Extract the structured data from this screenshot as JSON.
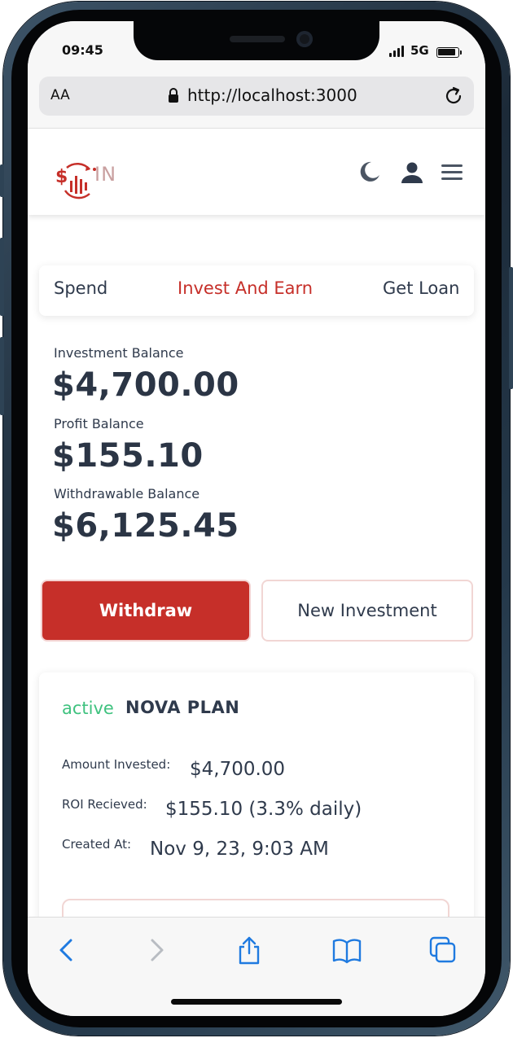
{
  "status_bar": {
    "time": "09:45",
    "network": "5G"
  },
  "browser": {
    "text_size_label": "AA",
    "url": "http://localhost:3000"
  },
  "header": {
    "logo_text": "IN"
  },
  "tabs": [
    {
      "label": "Spend"
    },
    {
      "label": "Invest And Earn",
      "active": true
    },
    {
      "label": "Get Loan"
    }
  ],
  "balances": {
    "investment": {
      "label": "Investment Balance",
      "value": "$4,700.00"
    },
    "profit": {
      "label": "Profit Balance",
      "value": "$155.10"
    },
    "withdrawable": {
      "label": "Withdrawable Balance",
      "value": "$6,125.45"
    }
  },
  "actions": {
    "withdraw_label": "Withdraw",
    "new_investment_label": "New Investment"
  },
  "investment": {
    "status": "active",
    "plan": "NOVA PLAN",
    "amount_label": "Amount Invested:",
    "amount_value": "$4,700.00",
    "roi_label": "ROI Recieved:",
    "roi_value": "$155.10 (3.3% daily)",
    "created_label": "Created At:",
    "created_value": "Nov 9, 23, 9:03 AM"
  },
  "colors": {
    "accent": "#c62f29",
    "active_status": "#3fc27f",
    "text": "#2f3a4c",
    "toolbar_blue": "#1f7ae0"
  },
  "icons": [
    "lock-icon",
    "reload-icon",
    "moon-icon",
    "user-icon",
    "menu-icon",
    "back-icon",
    "forward-icon",
    "share-icon",
    "bookmarks-icon",
    "tabs-icon"
  ]
}
